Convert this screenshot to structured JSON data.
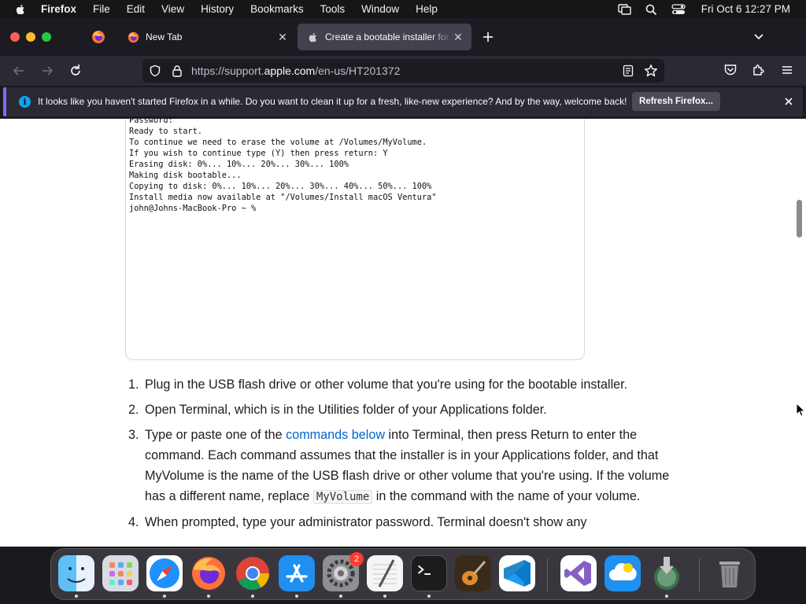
{
  "menubar": {
    "app_name": "Firefox",
    "items": [
      "File",
      "Edit",
      "View",
      "History",
      "Bookmarks",
      "Tools",
      "Window",
      "Help"
    ],
    "clock": "Fri Oct 6  12:27 PM"
  },
  "tabs": [
    {
      "label": "New Tab",
      "active": false
    },
    {
      "label": "Create a bootable installer for macOS",
      "active": true
    }
  ],
  "urlbar": {
    "prefix": "https://support.",
    "domain": "apple.com",
    "path": "/en-us/HT201372"
  },
  "notification": {
    "text": "It looks like you haven't started Firefox in a while. Do you want to clean it up for a fresh, like-new experience? And by the way, welcome back!",
    "button_label": "Refresh Firefox..."
  },
  "terminal": {
    "lines": [
      "Password:",
      "Ready to start.",
      "To continue we need to erase the volume at /Volumes/MyVolume.",
      "If you wish to continue type (Y) then press return: Y",
      "Erasing disk: 0%... 10%... 20%... 30%... 100%",
      "Making disk bootable...",
      "Copying to disk: 0%... 10%... 20%... 30%... 40%... 50%... 100%",
      "Install media now available at \"/Volumes/Install macOS Ventura\"",
      "john@Johns-MacBook-Pro ~ %"
    ]
  },
  "steps": {
    "s1": {
      "num": "1.",
      "text": "Plug in the USB flash drive or other volume that you're using for the bootable installer."
    },
    "s2": {
      "num": "2.",
      "text": "Open Terminal, which is in the Utilities folder of your Applications folder."
    },
    "s3": {
      "num": "3.",
      "before": "Type or paste one of the ",
      "link": "commands below",
      "middle": " into Terminal, then press Return to enter the command. Each command assumes that the installer is in your Applications folder, and that MyVolume is the name of the USB flash drive or other volume that you're using. If the volume has a different name, replace ",
      "code": "MyVolume",
      "after": " in the command with the name of your volume."
    },
    "s4": {
      "num": "4.",
      "text": "When prompted, type your administrator password. Terminal doesn't show any"
    }
  },
  "dock": {
    "apps": [
      "Finder",
      "Launchpad",
      "Safari",
      "Firefox",
      "Google Chrome",
      "App Store",
      "System Settings",
      "TextEdit",
      "Terminal",
      "GarageBand",
      "Visual Studio Code",
      "Visual Studio",
      "iCloud",
      "Install macOS Ventura",
      "Trash"
    ],
    "settings_badge": "2"
  },
  "colors": {
    "accent_link": "#0066cc",
    "notification_accent": "#8566ff",
    "info_icon": "#0ea5f2"
  }
}
